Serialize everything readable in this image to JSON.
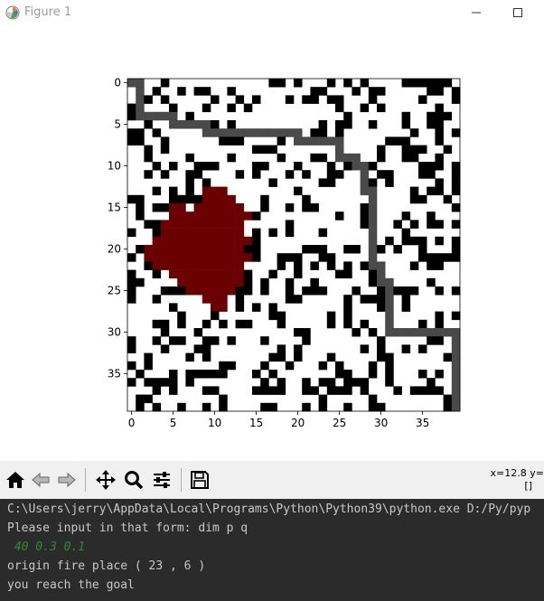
{
  "window": {
    "title": "Figure 1",
    "icons": {
      "app": "matplotlib-logo-icon",
      "minimize": "minimize-icon",
      "maximize": "maximize-icon"
    }
  },
  "toolbar": {
    "buttons": [
      {
        "name": "home-button",
        "icon": "home-icon"
      },
      {
        "name": "back-button",
        "icon": "back-arrow-icon"
      },
      {
        "name": "forward-button",
        "icon": "forward-arrow-icon"
      },
      {
        "name": "pan-button",
        "icon": "move-icon"
      },
      {
        "name": "zoom-button",
        "icon": "magnifier-icon"
      },
      {
        "name": "configure-subplots-button",
        "icon": "sliders-icon"
      },
      {
        "name": "save-button",
        "icon": "floppy-disk-icon"
      }
    ],
    "coords_line1": "x=12.8 y=",
    "coords_line2": "[]"
  },
  "plot": {
    "xticks": [
      "0",
      "5",
      "10",
      "15",
      "20",
      "25",
      "30",
      "35"
    ],
    "yticks": [
      "0",
      "5",
      "10",
      "15",
      "20",
      "25",
      "30",
      "35"
    ],
    "grid_size": 40,
    "colors": {
      "obstacle": "#000000",
      "free": "#ffffff",
      "path": "#4a4a4a",
      "fire": "#6b0000"
    },
    "path": [
      [
        0,
        0
      ],
      [
        1,
        0
      ],
      [
        1,
        1
      ],
      [
        1,
        2
      ],
      [
        1,
        3
      ],
      [
        1,
        4
      ],
      [
        2,
        4
      ],
      [
        3,
        4
      ],
      [
        4,
        4
      ],
      [
        5,
        4
      ],
      [
        5,
        5
      ],
      [
        6,
        5
      ],
      [
        7,
        5
      ],
      [
        8,
        5
      ],
      [
        9,
        5
      ],
      [
        9,
        6
      ],
      [
        10,
        6
      ],
      [
        11,
        6
      ],
      [
        12,
        6
      ],
      [
        13,
        6
      ],
      [
        14,
        6
      ],
      [
        15,
        6
      ],
      [
        16,
        6
      ],
      [
        17,
        6
      ],
      [
        18,
        6
      ],
      [
        19,
        6
      ],
      [
        20,
        6
      ],
      [
        20,
        7
      ],
      [
        21,
        7
      ],
      [
        22,
        7
      ],
      [
        23,
        7
      ],
      [
        24,
        7
      ],
      [
        25,
        7
      ],
      [
        25,
        8
      ],
      [
        25,
        9
      ],
      [
        26,
        9
      ],
      [
        27,
        9
      ],
      [
        27,
        10
      ],
      [
        28,
        10
      ],
      [
        28,
        11
      ],
      [
        28,
        12
      ],
      [
        28,
        13
      ],
      [
        29,
        13
      ],
      [
        29,
        14
      ],
      [
        29,
        15
      ],
      [
        29,
        16
      ],
      [
        29,
        17
      ],
      [
        29,
        18
      ],
      [
        29,
        19
      ],
      [
        29,
        20
      ],
      [
        29,
        21
      ],
      [
        29,
        22
      ],
      [
        30,
        22
      ],
      [
        30,
        23
      ],
      [
        30,
        24
      ],
      [
        31,
        24
      ],
      [
        31,
        25
      ],
      [
        31,
        26
      ],
      [
        31,
        27
      ],
      [
        31,
        28
      ],
      [
        31,
        29
      ],
      [
        31,
        30
      ],
      [
        32,
        30
      ],
      [
        33,
        30
      ],
      [
        34,
        30
      ],
      [
        35,
        30
      ],
      [
        36,
        30
      ],
      [
        37,
        30
      ],
      [
        38,
        30
      ],
      [
        39,
        30
      ],
      [
        39,
        31
      ],
      [
        39,
        32
      ],
      [
        39,
        33
      ],
      [
        39,
        34
      ],
      [
        39,
        35
      ],
      [
        39,
        36
      ],
      [
        39,
        37
      ],
      [
        39,
        38
      ],
      [
        39,
        39
      ]
    ],
    "fire_cells": [
      [
        9,
        13
      ],
      [
        10,
        13
      ],
      [
        11,
        13
      ],
      [
        9,
        14
      ],
      [
        10,
        14
      ],
      [
        11,
        14
      ],
      [
        12,
        14
      ],
      [
        5,
        15
      ],
      [
        6,
        15
      ],
      [
        8,
        15
      ],
      [
        9,
        15
      ],
      [
        10,
        15
      ],
      [
        11,
        15
      ],
      [
        12,
        15
      ],
      [
        13,
        15
      ],
      [
        5,
        16
      ],
      [
        6,
        16
      ],
      [
        7,
        16
      ],
      [
        8,
        16
      ],
      [
        9,
        16
      ],
      [
        10,
        16
      ],
      [
        11,
        16
      ],
      [
        12,
        16
      ],
      [
        13,
        16
      ],
      [
        14,
        16
      ],
      [
        4,
        17
      ],
      [
        5,
        17
      ],
      [
        6,
        17
      ],
      [
        7,
        17
      ],
      [
        8,
        17
      ],
      [
        9,
        17
      ],
      [
        10,
        17
      ],
      [
        11,
        17
      ],
      [
        12,
        17
      ],
      [
        13,
        17
      ],
      [
        4,
        18
      ],
      [
        5,
        18
      ],
      [
        6,
        18
      ],
      [
        7,
        18
      ],
      [
        8,
        18
      ],
      [
        9,
        18
      ],
      [
        10,
        18
      ],
      [
        11,
        18
      ],
      [
        12,
        18
      ],
      [
        13,
        18
      ],
      [
        3,
        19
      ],
      [
        4,
        19
      ],
      [
        5,
        19
      ],
      [
        6,
        19
      ],
      [
        7,
        19
      ],
      [
        8,
        19
      ],
      [
        9,
        19
      ],
      [
        10,
        19
      ],
      [
        11,
        19
      ],
      [
        12,
        19
      ],
      [
        13,
        19
      ],
      [
        14,
        19
      ],
      [
        2,
        20
      ],
      [
        3,
        20
      ],
      [
        4,
        20
      ],
      [
        5,
        20
      ],
      [
        6,
        20
      ],
      [
        7,
        20
      ],
      [
        8,
        20
      ],
      [
        9,
        20
      ],
      [
        10,
        20
      ],
      [
        11,
        20
      ],
      [
        12,
        20
      ],
      [
        13,
        20
      ],
      [
        2,
        21
      ],
      [
        3,
        21
      ],
      [
        4,
        21
      ],
      [
        5,
        21
      ],
      [
        6,
        21
      ],
      [
        7,
        21
      ],
      [
        8,
        21
      ],
      [
        9,
        21
      ],
      [
        10,
        21
      ],
      [
        11,
        21
      ],
      [
        12,
        21
      ],
      [
        13,
        21
      ],
      [
        14,
        21
      ],
      [
        3,
        22
      ],
      [
        4,
        22
      ],
      [
        5,
        22
      ],
      [
        6,
        22
      ],
      [
        7,
        22
      ],
      [
        8,
        22
      ],
      [
        9,
        22
      ],
      [
        10,
        22
      ],
      [
        11,
        22
      ],
      [
        12,
        22
      ],
      [
        13,
        22
      ],
      [
        5,
        23
      ],
      [
        6,
        23
      ],
      [
        7,
        23
      ],
      [
        8,
        23
      ],
      [
        9,
        23
      ],
      [
        10,
        23
      ],
      [
        11,
        23
      ],
      [
        12,
        23
      ],
      [
        13,
        23
      ],
      [
        6,
        24
      ],
      [
        7,
        24
      ],
      [
        8,
        24
      ],
      [
        9,
        24
      ],
      [
        10,
        24
      ],
      [
        11,
        24
      ],
      [
        12,
        24
      ],
      [
        13,
        24
      ],
      [
        7,
        25
      ],
      [
        8,
        25
      ],
      [
        9,
        25
      ],
      [
        10,
        25
      ],
      [
        11,
        25
      ],
      [
        12,
        25
      ],
      [
        9,
        26
      ],
      [
        10,
        26
      ],
      [
        11,
        26
      ],
      [
        10,
        27
      ],
      [
        11,
        27
      ]
    ]
  },
  "console": {
    "command": "C:\\Users\\jerry\\AppData\\Local\\Programs\\Python\\Python39\\python.exe D:/Py/pyp",
    "prompt": "Please input in that form: dim p q",
    "user_input": " 40 0.3 0.1",
    "fire_message": "origin fire place ( 23 , 6 )",
    "goal_message": "you reach the goal"
  }
}
